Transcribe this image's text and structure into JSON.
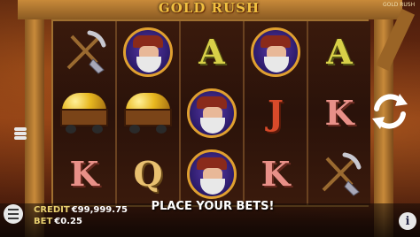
{
  "game": {
    "title": "GOLD RUSH",
    "brand_mini": "GOLD RUSH",
    "place_bets": "PLACE YOUR BETS!"
  },
  "hud": {
    "credit_label": "CREDIT",
    "credit_value": "€99,999.75",
    "bet_label": "BET",
    "bet_value": "€0.25"
  },
  "reels": [
    [
      "pickaxe-shovel",
      "gold-cart",
      "K"
    ],
    [
      "miner",
      "gold-cart",
      "Q"
    ],
    [
      "A",
      "miner",
      "miner"
    ],
    [
      "miner",
      "J",
      "K"
    ],
    [
      "A",
      "K",
      "pickaxe-shovel"
    ]
  ],
  "colors": {
    "accent": "#f0c040",
    "frame": "#a07030",
    "reel_bg": "#2a120a"
  },
  "icons": {
    "spin": "spin-arrows-icon",
    "menu": "hamburger-menu-icon",
    "info": "info-icon",
    "coins": "coin-stack-icon"
  }
}
